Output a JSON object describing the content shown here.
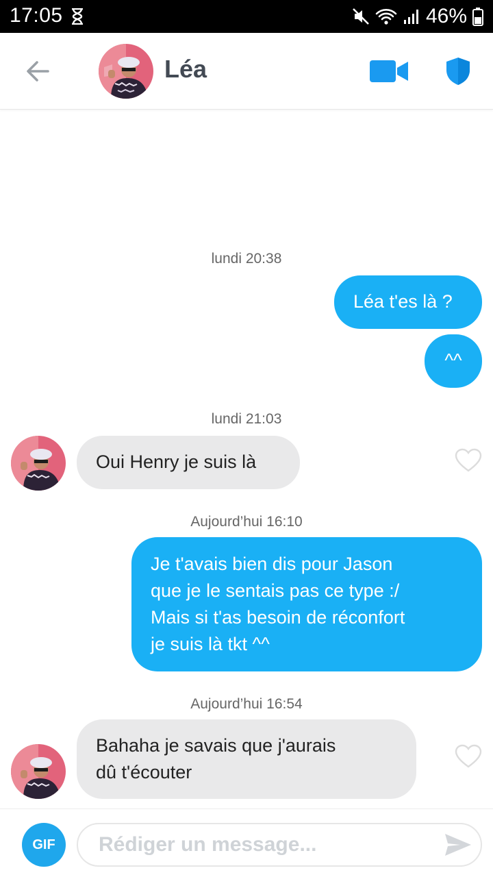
{
  "status_bar": {
    "time": "17:05",
    "battery": "46%"
  },
  "header": {
    "name": "Léa",
    "back_icon": "arrow-left-icon",
    "video_icon": "video-camera-icon",
    "safety_icon": "shield-icon",
    "accent": "#1a9af0"
  },
  "messages": [
    {
      "type": "timestamp",
      "day": "lundi",
      "time": "20:38"
    },
    {
      "type": "sent",
      "text": "Léa t'es là ?"
    },
    {
      "type": "sent",
      "text": "^^"
    },
    {
      "type": "timestamp",
      "day": "lundi",
      "time": "21:03"
    },
    {
      "type": "received",
      "text": "Oui Henry je suis là"
    },
    {
      "type": "timestamp",
      "day": "Aujourd’hui",
      "time": "16:10"
    },
    {
      "type": "sent",
      "lines": [
        "Je t'avais bien dis pour Jason",
        "que je le sentais pas ce type :/",
        "Mais si t'as besoin de réconfort",
        "je suis là tkt ^^"
      ]
    },
    {
      "type": "timestamp",
      "day": "Aujourd’hui",
      "time": "16:54"
    },
    {
      "type": "received",
      "lines": [
        "Bahaha je savais que j'aurais",
        "dû t'écouter"
      ]
    }
  ],
  "composer": {
    "gif_label": "GIF",
    "placeholder": "Rédiger un message...",
    "value": "",
    "send_icon": "send-icon"
  },
  "colors": {
    "sent_bubble": "#1ab0f5",
    "received_bubble": "#e9e9ea",
    "gif_button": "#1fa7ec"
  }
}
